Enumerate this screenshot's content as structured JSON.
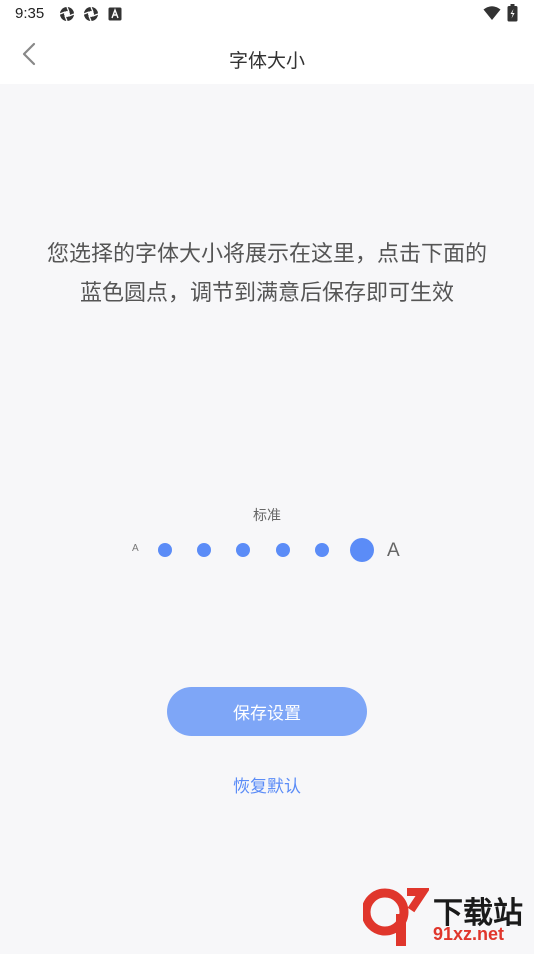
{
  "status_bar": {
    "time": "9:35",
    "icons": [
      "aperture-icon",
      "aperture-icon",
      "a-box-icon",
      "wifi-icon",
      "battery-icon"
    ]
  },
  "header": {
    "back_icon": "chevron-left-icon",
    "title": "字体大小"
  },
  "preview": {
    "line1": "您选择的字体大小将展示在这里，点击下面的",
    "line2": "蓝色圆点，调节到满意后保存即可生效"
  },
  "size_selector": {
    "current_label": "标准",
    "small_marker": "A",
    "large_marker": "A",
    "levels": 6,
    "selected_index": 5,
    "accent_color": "#5b8cf7"
  },
  "actions": {
    "save_label": "保存设置",
    "reset_label": "恢复默认"
  },
  "watermark": {
    "logo_text": "下载站",
    "url_text": "91xz.net"
  }
}
